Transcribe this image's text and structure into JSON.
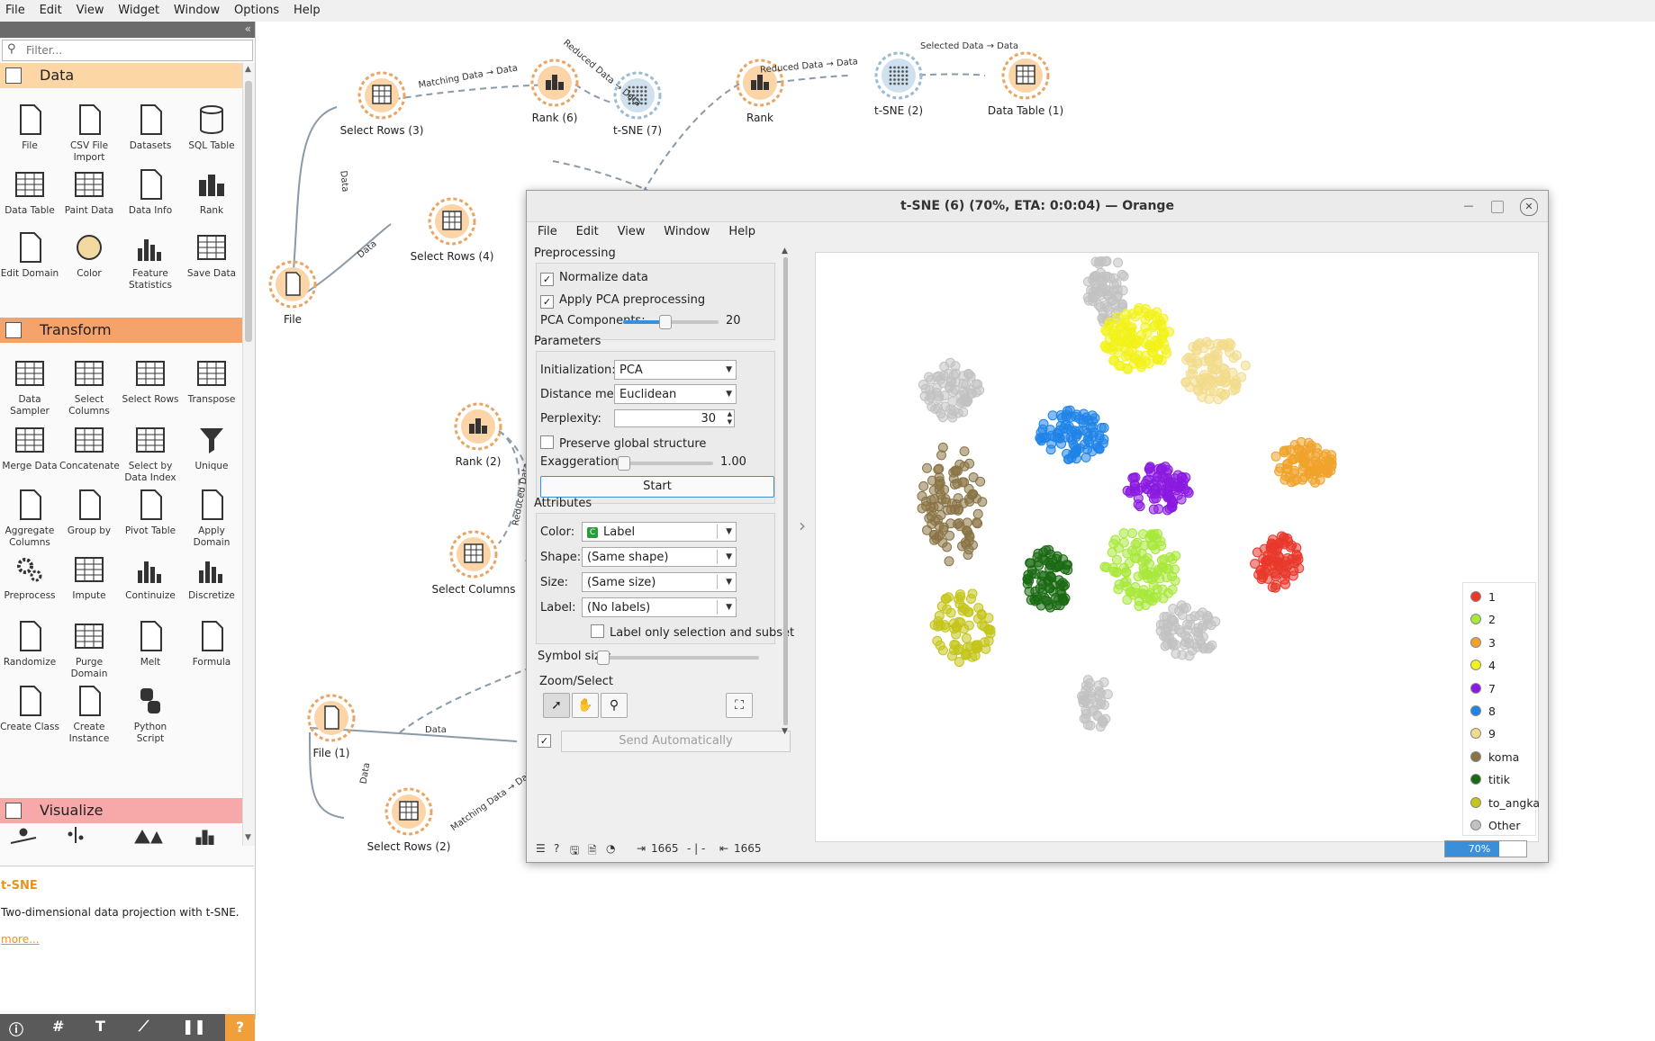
{
  "menubar": [
    "File",
    "Edit",
    "View",
    "Widget",
    "Window",
    "Options",
    "Help"
  ],
  "toolbox": {
    "filter_placeholder": "Filter...",
    "categories": {
      "data": "Data",
      "transform": "Transform",
      "visualize": "Visualize"
    },
    "data_widgets": [
      "File",
      "CSV File Import",
      "Datasets",
      "SQL Table",
      "Data Table",
      "Paint Data",
      "Data Info",
      "Rank",
      "Edit Domain",
      "Color",
      "Feature Statistics",
      "Save Data"
    ],
    "transform_widgets": [
      "Data Sampler",
      "Select Columns",
      "Select Rows",
      "Transpose",
      "Merge Data",
      "Concatenate",
      "Select by Data Index",
      "Unique",
      "Aggregate Columns",
      "Group by",
      "Pivot Table",
      "Apply Domain",
      "Preprocess",
      "Impute",
      "Continuize",
      "Discretize",
      "Randomize",
      "Purge Domain",
      "Melt",
      "Formula",
      "Create Class",
      "Create Instance",
      "Python Script"
    ],
    "help": {
      "title": "t-SNE",
      "description": "Two-dimensional data projection with t-SNE.",
      "more": "more..."
    }
  },
  "canvas": {
    "nodes": [
      "Select Rows (3)",
      "Rank (6)",
      "t-SNE (7)",
      "Rank",
      "t-SNE (2)",
      "Data Table (1)",
      "Select Rows (4)",
      "File",
      "Rank (2)",
      "Select Columns",
      "File (1)",
      "Select Rows (2)",
      "Rank"
    ],
    "link_labels": [
      "Matching Data → Data",
      "Reduced Data → Data",
      "Reduced Data → Data",
      "Selected Data → Data",
      "Data",
      "Data",
      "Reduced Data",
      "Data",
      "Data",
      "Data",
      "Matching Data → Data",
      "Data"
    ]
  },
  "dialog": {
    "title": "t-SNE (6) (70%, ETA: 0:0:04) — Orange",
    "menu": [
      "File",
      "Edit",
      "View",
      "Window",
      "Help"
    ],
    "preprocessing": {
      "label": "Preprocessing",
      "normalize": "Normalize data",
      "pca": "Apply PCA preprocessing",
      "pca_components_label": "PCA Components:",
      "pca_components": "20",
      "pca_components_fraction": 0.43
    },
    "parameters": {
      "label": "Parameters",
      "init_label": "Initialization:",
      "init_value": "PCA",
      "metric_label": "Distance metric:",
      "metric_value": "Euclidean",
      "perplexity_label": "Perplexity:",
      "perplexity_value": "30",
      "preserve_global": "Preserve global structure",
      "exaggeration_label": "Exaggeration:",
      "exaggeration_value": "1.00",
      "exaggeration_fraction": 0.0,
      "start": "Start"
    },
    "attributes": {
      "label": "Attributes",
      "color_label": "Color:",
      "color_value": "Label",
      "color_badge": "C",
      "shape_label": "Shape:",
      "shape_value": "(Same shape)",
      "size_label": "Size:",
      "size_value": "(Same size)",
      "label_label": "Label:",
      "label_value": "(No labels)",
      "label_only": "Label only selection and subset",
      "symbol_size_label": "Symbol size:",
      "symbol_size_fraction": 0.0
    },
    "zoom_select": "Zoom/Select",
    "send_auto": "Send Automatically",
    "status": {
      "in_count": "1665",
      "sep": "- | -",
      "out_count": "1665"
    },
    "progress_percent": 70,
    "progress_label": "70%",
    "legend": [
      {
        "label": "1",
        "color": "#e8392b"
      },
      {
        "label": "2",
        "color": "#a8e83a"
      },
      {
        "label": "3",
        "color": "#f0a22a"
      },
      {
        "label": "4",
        "color": "#f2f21a"
      },
      {
        "label": "7",
        "color": "#8a1ae0"
      },
      {
        "label": "8",
        "color": "#1f84e8"
      },
      {
        "label": "9",
        "color": "#f2dc8c"
      },
      {
        "label": "koma",
        "color": "#8a7446"
      },
      {
        "label": "titik",
        "color": "#1a6a12"
      },
      {
        "label": "to_angka",
        "color": "#c4c41a"
      },
      {
        "label": "Other",
        "color": "#c2c2c2"
      }
    ]
  },
  "colors": {
    "accent": "#3b8fd9",
    "data_cat": "#fcd6a4",
    "transform_cat": "#f5a36b",
    "visualize_cat": "#f7a9a9",
    "help_title": "#e69418"
  }
}
